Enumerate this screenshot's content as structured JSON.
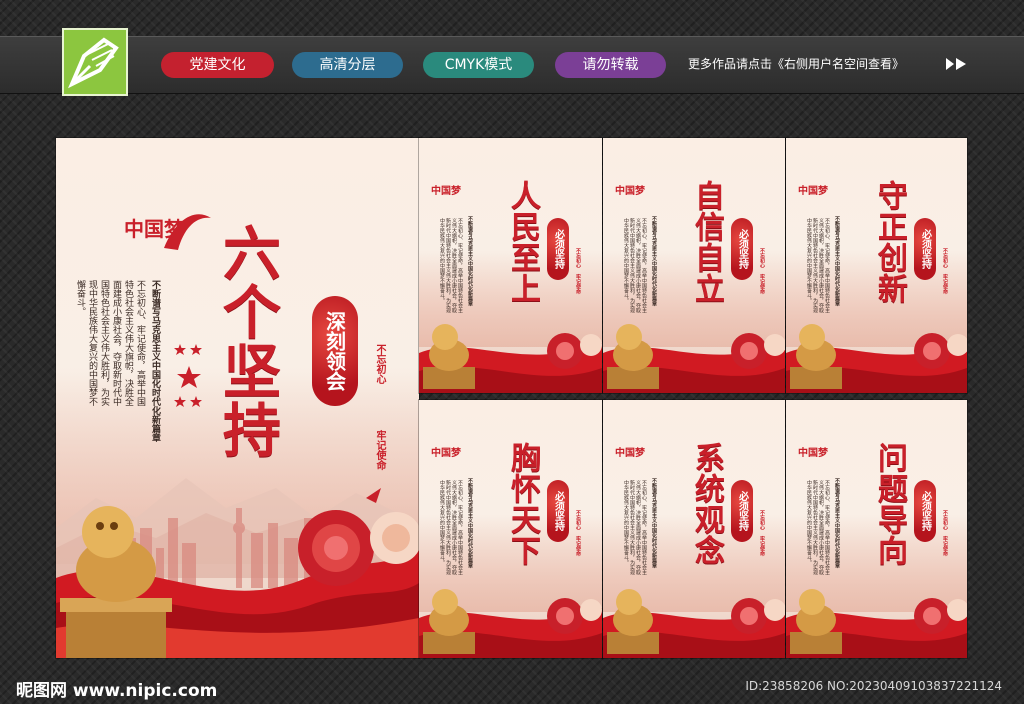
{
  "header": {
    "tags": [
      "党建文化",
      "高清分层",
      "CMYK模式",
      "请勿转载"
    ],
    "notice": "更多作品请点击《右侧用户名空间查看》"
  },
  "main_poster": {
    "emblem": "中国梦",
    "title": "六个坚持",
    "subtitle": "深刻领会",
    "slogan_left": "不忘初心",
    "slogan_right": "牢记使命",
    "heading_text": "不断谱写马克思主义中国化时代化新篇章",
    "body_text": "不忘初心、牢记使命，高举中国特色社会主义伟大旗帜，决胜全面建成小康社会，夺取新时代中国特色社会主义伟大胜利，为实现中华民族伟大复兴的中国梦不懈奋斗。"
  },
  "small_posters": [
    {
      "title": "人民至上",
      "seal": "必须坚持"
    },
    {
      "title": "自信自立",
      "seal": "必须坚持"
    },
    {
      "title": "守正创新",
      "seal": "必须坚持"
    },
    {
      "title": "胸怀天下",
      "seal": "必须坚持"
    },
    {
      "title": "系统观念",
      "seal": "必须坚持"
    },
    {
      "title": "问题导向",
      "seal": "必须坚持"
    }
  ],
  "small_slogan": "不忘初心 牢记使命",
  "footer": {
    "brand": "昵图网 www.nipic.com",
    "id": "ID:23858206 NO:20230409103837221124"
  },
  "colors": {
    "party_red": "#c9202a",
    "logo_green": "#8cc63f"
  }
}
